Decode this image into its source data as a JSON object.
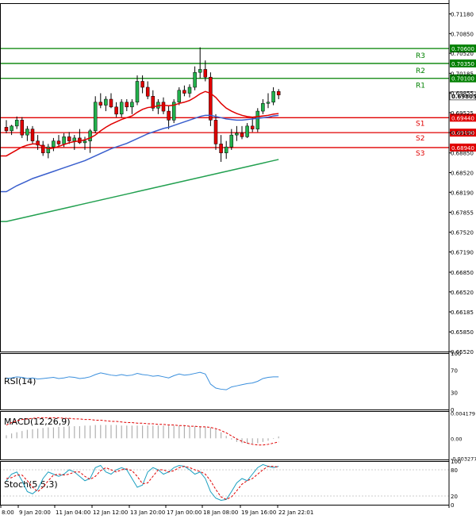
{
  "chart_data": {
    "type": "candlestick",
    "main": {
      "price_axis_ticks": [
        "0.71180",
        "0.70850",
        "0.70520",
        "0.70185",
        "0.69855",
        "0.69525",
        "0.69190",
        "0.68850",
        "0.68520",
        "0.68190",
        "0.67855",
        "0.67520",
        "0.67190",
        "0.66850",
        "0.66520",
        "0.66185",
        "0.65850",
        "0.65520"
      ],
      "ylim": [
        0.6552,
        0.7136
      ],
      "levels": [
        {
          "name": "R3",
          "value": 0.706,
          "label": "0.70600",
          "color": "#008000"
        },
        {
          "name": "R2",
          "value": 0.7035,
          "label": "0.70350",
          "color": "#008000"
        },
        {
          "name": "R1",
          "value": 0.701,
          "label": "0.70100",
          "color": "#008000"
        },
        {
          "name": "S1",
          "value": 0.6944,
          "label": "0.69440",
          "color": "#e00000"
        },
        {
          "name": "S2",
          "value": 0.6919,
          "label": "0.69190",
          "color": "#e00000"
        },
        {
          "name": "S3",
          "value": 0.6894,
          "label": "0.68940",
          "color": "#e00000"
        }
      ],
      "current_price": "0.69805",
      "candles": [
        [
          0.6928,
          0.694,
          0.6918,
          0.6922
        ],
        [
          0.6922,
          0.6932,
          0.6915,
          0.693
        ],
        [
          0.693,
          0.6946,
          0.6925,
          0.694
        ],
        [
          0.694,
          0.6945,
          0.691,
          0.6915
        ],
        [
          0.6915,
          0.693,
          0.6905,
          0.6925
        ],
        [
          0.6925,
          0.693,
          0.69,
          0.6905
        ],
        [
          0.6905,
          0.6915,
          0.689,
          0.6898
        ],
        [
          0.6898,
          0.6905,
          0.688,
          0.6885
        ],
        [
          0.6885,
          0.69,
          0.6876,
          0.6895
        ],
        [
          0.6895,
          0.691,
          0.6888,
          0.6905
        ],
        [
          0.6905,
          0.6915,
          0.6895,
          0.69
        ],
        [
          0.69,
          0.6918,
          0.6895,
          0.6912
        ],
        [
          0.6912,
          0.692,
          0.69,
          0.6905
        ],
        [
          0.6905,
          0.6915,
          0.689,
          0.691
        ],
        [
          0.691,
          0.6925,
          0.69,
          0.6902
        ],
        [
          0.6902,
          0.6912,
          0.689,
          0.6905
        ],
        [
          0.6905,
          0.6925,
          0.6885,
          0.6922
        ],
        [
          0.6922,
          0.698,
          0.6918,
          0.697
        ],
        [
          0.697,
          0.6985,
          0.696,
          0.6965
        ],
        [
          0.6965,
          0.698,
          0.6955,
          0.6975
        ],
        [
          0.6975,
          0.6985,
          0.696,
          0.6962
        ],
        [
          0.6962,
          0.697,
          0.6945,
          0.695
        ],
        [
          0.695,
          0.6975,
          0.6945,
          0.697
        ],
        [
          0.697,
          0.6975,
          0.6955,
          0.6962
        ],
        [
          0.6962,
          0.6975,
          0.695,
          0.697
        ],
        [
          0.697,
          0.7015,
          0.6965,
          0.7005
        ],
        [
          0.7005,
          0.7015,
          0.6985,
          0.6995
        ],
        [
          0.6995,
          0.7005,
          0.6975,
          0.698
        ],
        [
          0.698,
          0.699,
          0.6955,
          0.696
        ],
        [
          0.696,
          0.6975,
          0.695,
          0.697
        ],
        [
          0.697,
          0.6978,
          0.695,
          0.6955
        ],
        [
          0.6955,
          0.6965,
          0.6925,
          0.694
        ],
        [
          0.694,
          0.6975,
          0.6935,
          0.697
        ],
        [
          0.697,
          0.6995,
          0.6965,
          0.699
        ],
        [
          0.699,
          0.6998,
          0.698,
          0.6985
        ],
        [
          0.6985,
          0.7,
          0.6978,
          0.6995
        ],
        [
          0.6995,
          0.703,
          0.699,
          0.702
        ],
        [
          0.702,
          0.7062,
          0.701,
          0.7025
        ],
        [
          0.7025,
          0.704,
          0.7005,
          0.7012
        ],
        [
          0.7012,
          0.702,
          0.693,
          0.694
        ],
        [
          0.694,
          0.695,
          0.689,
          0.69
        ],
        [
          0.69,
          0.6915,
          0.687,
          0.6885
        ],
        [
          0.6885,
          0.6905,
          0.6875,
          0.6895
        ],
        [
          0.6895,
          0.6925,
          0.689,
          0.6915
        ],
        [
          0.6915,
          0.693,
          0.6905,
          0.6918
        ],
        [
          0.6918,
          0.693,
          0.6908,
          0.6912
        ],
        [
          0.6912,
          0.6935,
          0.691,
          0.693
        ],
        [
          0.693,
          0.6945,
          0.692,
          0.6925
        ],
        [
          0.6925,
          0.696,
          0.692,
          0.6955
        ],
        [
          0.6955,
          0.6975,
          0.695,
          0.6968
        ],
        [
          0.6968,
          0.6985,
          0.696,
          0.697
        ],
        [
          0.697,
          0.6995,
          0.6965,
          0.6988
        ],
        [
          0.6988,
          0.6992,
          0.6975,
          0.6982
        ]
      ],
      "ma_red": [
        0.688,
        0.6885,
        0.689,
        0.6895,
        0.6898,
        0.69,
        0.69,
        0.6895,
        0.6892,
        0.6893,
        0.6896,
        0.6899,
        0.6902,
        0.6904,
        0.6905,
        0.6907,
        0.691,
        0.6915,
        0.6922,
        0.6928,
        0.6933,
        0.6937,
        0.6941,
        0.6944,
        0.6947,
        0.6953,
        0.6958,
        0.6961,
        0.6962,
        0.6964,
        0.6965,
        0.6964,
        0.6965,
        0.6968,
        0.697,
        0.6973,
        0.6978,
        0.6984,
        0.6988,
        0.6985,
        0.6978,
        0.6968,
        0.696,
        0.6955,
        0.6951,
        0.6948,
        0.6946,
        0.6945,
        0.6946,
        0.6947,
        0.6948,
        0.695,
        0.6951
      ],
      "ma_blue": [
        0.682,
        0.6825,
        0.683,
        0.6834,
        0.6838,
        0.6842,
        0.6845,
        0.6848,
        0.6851,
        0.6854,
        0.6857,
        0.686,
        0.6863,
        0.6866,
        0.6869,
        0.6872,
        0.6876,
        0.688,
        0.6884,
        0.6888,
        0.6892,
        0.6895,
        0.6898,
        0.6901,
        0.6905,
        0.6909,
        0.6913,
        0.6917,
        0.692,
        0.6923,
        0.6926,
        0.6928,
        0.6931,
        0.6934,
        0.6937,
        0.694,
        0.6943,
        0.6946,
        0.6948,
        0.6948,
        0.6946,
        0.6944,
        0.6942,
        0.6941,
        0.694,
        0.694,
        0.6941,
        0.6942,
        0.6943,
        0.6944,
        0.6945,
        0.6947,
        0.6948
      ],
      "ma_green": [
        0.677,
        0.6772,
        0.6774,
        0.6776,
        0.6778,
        0.678,
        0.6782,
        0.6784,
        0.6786,
        0.6788,
        0.679,
        0.6792,
        0.6794,
        0.6796,
        0.6798,
        0.68,
        0.6802,
        0.6804,
        0.6806,
        0.6808,
        0.681,
        0.6812,
        0.6814,
        0.6816,
        0.6818,
        0.682,
        0.6822,
        0.6824,
        0.6826,
        0.6828,
        0.683,
        0.6832,
        0.6834,
        0.6836,
        0.6838,
        0.684,
        0.6842,
        0.6844,
        0.6846,
        0.6848,
        0.685,
        0.6852,
        0.6854,
        0.6856,
        0.6858,
        0.686,
        0.6862,
        0.6864,
        0.6866,
        0.6868,
        0.687,
        0.6872,
        0.6874
      ]
    },
    "rsi": {
      "label": "RSI(14)",
      "axis_ticks": [
        "100",
        "70",
        "30",
        "0"
      ],
      "ylim": [
        0,
        100
      ],
      "values": [
        55,
        56,
        58,
        57,
        55,
        56,
        54,
        55,
        56,
        57,
        55,
        56,
        58,
        57,
        55,
        56,
        58,
        62,
        65,
        63,
        61,
        60,
        62,
        60,
        61,
        64,
        62,
        61,
        59,
        60,
        58,
        56,
        60,
        63,
        61,
        62,
        64,
        66,
        63,
        45,
        38,
        36,
        35,
        40,
        42,
        44,
        46,
        47,
        50,
        55,
        57,
        58,
        58
      ]
    },
    "macd": {
      "label": "MACD(12,26,9)",
      "axis_ticks": [
        "0.004179",
        "0.00",
        "-0.003277"
      ],
      "ylim": [
        -0.0035,
        0.0045
      ],
      "histogram": [
        0.0005,
        0.0008,
        0.001,
        0.0012,
        0.0014,
        0.0015,
        0.0016,
        0.0017,
        0.0018,
        0.0018,
        0.0019,
        0.0019,
        0.002,
        0.002,
        0.002,
        0.0021,
        0.0021,
        0.0022,
        0.0022,
        0.0022,
        0.0022,
        0.0022,
        0.0021,
        0.0021,
        0.0021,
        0.0021,
        0.0021,
        0.0021,
        0.0021,
        0.0021,
        0.0021,
        0.0021,
        0.0021,
        0.0021,
        0.0021,
        0.002,
        0.002,
        0.002,
        0.0019,
        0.0018,
        0.0015,
        0.001,
        0.0004,
        -0.0002,
        -0.0006,
        -0.0008,
        -0.0009,
        -0.0009,
        -0.0008,
        -0.0006,
        -0.0004,
        -0.0001,
        0.0003
      ],
      "signal": [
        0.0022,
        0.0026,
        0.0029,
        0.0031,
        0.0032,
        0.0033,
        0.0034,
        0.0034,
        0.0034,
        0.0034,
        0.0034,
        0.0033,
        0.0033,
        0.0032,
        0.0032,
        0.0031,
        0.0031,
        0.003,
        0.003,
        0.0029,
        0.0028,
        0.0028,
        0.0027,
        0.0026,
        0.0026,
        0.0025,
        0.0025,
        0.0024,
        0.0024,
        0.0023,
        0.0023,
        0.0022,
        0.0022,
        0.0021,
        0.0021,
        0.002,
        0.002,
        0.0019,
        0.0019,
        0.0018,
        0.0016,
        0.0013,
        0.0009,
        0.0004,
        -0.0001,
        -0.0005,
        -0.0008,
        -0.001,
        -0.0011,
        -0.0011,
        -0.001,
        -0.0008,
        -0.0006
      ]
    },
    "stoch": {
      "label": "Stoch(5,5,3)",
      "axis_ticks": [
        "100",
        "80",
        "20",
        "0"
      ],
      "ylim": [
        0,
        100
      ],
      "main": [
        55,
        70,
        75,
        55,
        30,
        25,
        35,
        60,
        75,
        70,
        65,
        70,
        80,
        75,
        65,
        55,
        60,
        85,
        90,
        75,
        70,
        80,
        85,
        80,
        60,
        40,
        45,
        75,
        85,
        80,
        70,
        75,
        85,
        90,
        88,
        80,
        70,
        75,
        60,
        30,
        15,
        10,
        12,
        30,
        50,
        60,
        55,
        70,
        85,
        92,
        88,
        85,
        88
      ],
      "signal": [
        60,
        62,
        68,
        68,
        55,
        40,
        30,
        40,
        55,
        68,
        70,
        68,
        70,
        75,
        75,
        65,
        58,
        65,
        78,
        85,
        80,
        75,
        80,
        82,
        78,
        65,
        48,
        50,
        65,
        80,
        80,
        75,
        78,
        85,
        88,
        85,
        80,
        76,
        70,
        55,
        35,
        18,
        12,
        18,
        32,
        47,
        55,
        60,
        70,
        80,
        88,
        88,
        86
      ]
    },
    "x_tick_labels": [
      "8:00",
      "9 Jan 20:00",
      "11 Jan 04:00",
      "12 Jan 12:00",
      "13 Jan 20:00",
      "17 Jan 00:00",
      "18 Jan 08:00",
      "19 Jan 16:00",
      "22 Jan 22:01"
    ]
  }
}
